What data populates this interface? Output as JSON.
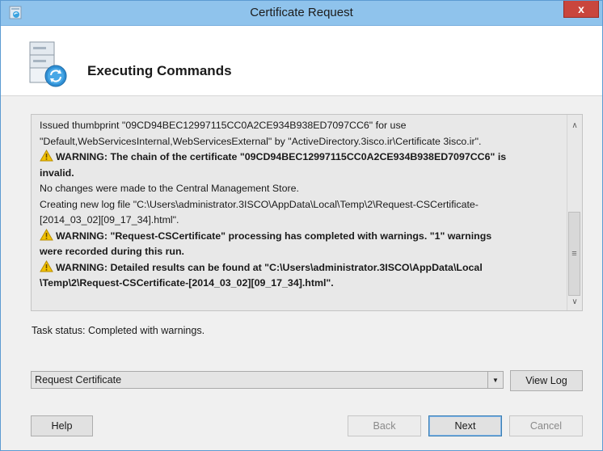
{
  "window": {
    "title": "Certificate Request",
    "close_label": "x"
  },
  "header": {
    "heading": "Executing Commands",
    "icon": "server-sync-icon"
  },
  "log": {
    "lines": [
      {
        "type": "text",
        "text": "Issued thumbprint \"09CD94BEC12997115CC0A2CE934B938ED7097CC6\" for use"
      },
      {
        "type": "text",
        "text": "\"Default,WebServicesInternal,WebServicesExternal\" by \"ActiveDirectory.3isco.ir\\Certificate 3isco.ir\"."
      },
      {
        "type": "warn",
        "text": "WARNING: The chain of the certificate \"09CD94BEC12997115CC0A2CE934B938ED7097CC6\" is"
      },
      {
        "type": "warn-cont",
        "text": "invalid."
      },
      {
        "type": "text",
        "text": "No changes were made to the Central Management Store."
      },
      {
        "type": "text",
        "text": "Creating new log file \"C:\\Users\\administrator.3ISCO\\AppData\\Local\\Temp\\2\\Request-CSCertificate-"
      },
      {
        "type": "text",
        "text": "[2014_03_02][09_17_34].html\"."
      },
      {
        "type": "warn",
        "text": "WARNING: \"Request-CSCertificate\" processing has completed with warnings. \"1\" warnings"
      },
      {
        "type": "warn-cont",
        "text": "were recorded during this run."
      },
      {
        "type": "warn",
        "text": "WARNING: Detailed results can be found at \"C:\\Users\\administrator.3ISCO\\AppData\\Local"
      },
      {
        "type": "warn-cont",
        "text": "\\Temp\\2\\Request-CSCertificate-[2014_03_02][09_17_34].html\"."
      }
    ],
    "warning_icon": "warning-icon"
  },
  "status": {
    "text": "Task status: Completed with warnings."
  },
  "combo": {
    "selected": "Request Certificate"
  },
  "buttons": {
    "view_log": "View Log",
    "help": "Help",
    "back": "Back",
    "next": "Next",
    "cancel": "Cancel"
  },
  "colors": {
    "titlebar": "#8fc3ec",
    "close": "#c9463d",
    "warning": "#f2c200"
  }
}
